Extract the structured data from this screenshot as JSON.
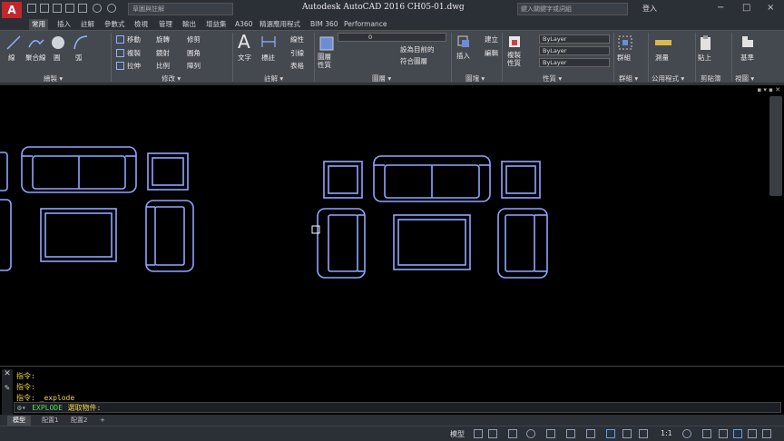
{
  "title_bar": {
    "app_letter": "A",
    "workspace": "草圖與註解",
    "title": "Autodesk AutoCAD 2016   CH05-01.dwg",
    "search_placeholder": "鍵入關鍵字或詞組",
    "login_label": "登入",
    "min": "−",
    "max": "□",
    "close": "×"
  },
  "tabs": [
    "常用",
    "插入",
    "註解",
    "參數式",
    "檢視",
    "管理",
    "輸出",
    "增益集",
    "A360",
    "精選應用程式",
    "BIM 360",
    "Performance"
  ],
  "active_tab": 0,
  "ribbon": {
    "draw": {
      "line": "線",
      "polyline": "聚合線",
      "circle": "圓",
      "arc": "弧",
      "label": "繪製 ▾"
    },
    "modify": {
      "move": "移動",
      "rotate": "旋轉",
      "trim": "修剪",
      "copy": "複製",
      "mirror": "鏡射",
      "fillet": "圓角",
      "stretch": "拉伸",
      "scale": "比例",
      "array": "陣列",
      "label": "修改 ▾"
    },
    "annotation": {
      "text": "文字",
      "dimension": "標註",
      "linear": "線性",
      "leader": "引線",
      "table": "表格",
      "label": "註解 ▾"
    },
    "layers": {
      "layer_props": "圖層性質",
      "layer_name": "0",
      "set_current": "設為目前的",
      "match": "符合圖層",
      "label": "圖層 ▾"
    },
    "block": {
      "insert": "插入",
      "create": "建立",
      "edit": "編輯",
      "label": "圖塊 ▾"
    },
    "properties": {
      "match": "複製性質",
      "color": "ByLayer",
      "linetype": "ByLayer",
      "lineweight": "ByLayer",
      "label": "性質 ▾"
    },
    "groups": {
      "group": "群組",
      "label": "群組 ▾"
    },
    "utilities": {
      "measure": "測量",
      "label": "公用程式 ▾"
    },
    "clipboard": {
      "paste": "貼上",
      "label": "剪貼簿"
    },
    "view": {
      "base": "基準",
      "label": "視圖 ▾"
    }
  },
  "command": {
    "lines": [
      "指令:",
      "指令:",
      "指令: _explode"
    ],
    "prompt_cmd": "EXPLODE",
    "prompt_text": "選取物件:"
  },
  "layout_tabs": [
    "模型",
    "配置1",
    "配置2",
    "+"
  ],
  "active_layout": 0,
  "status": {
    "model": "模型",
    "scale": "1:1"
  },
  "colors": {
    "drawing_lines": "#8fa6ff",
    "accent_red": "#c4262e",
    "command_text": "#f2d44a",
    "prompt_cmd": "#59d95a"
  }
}
